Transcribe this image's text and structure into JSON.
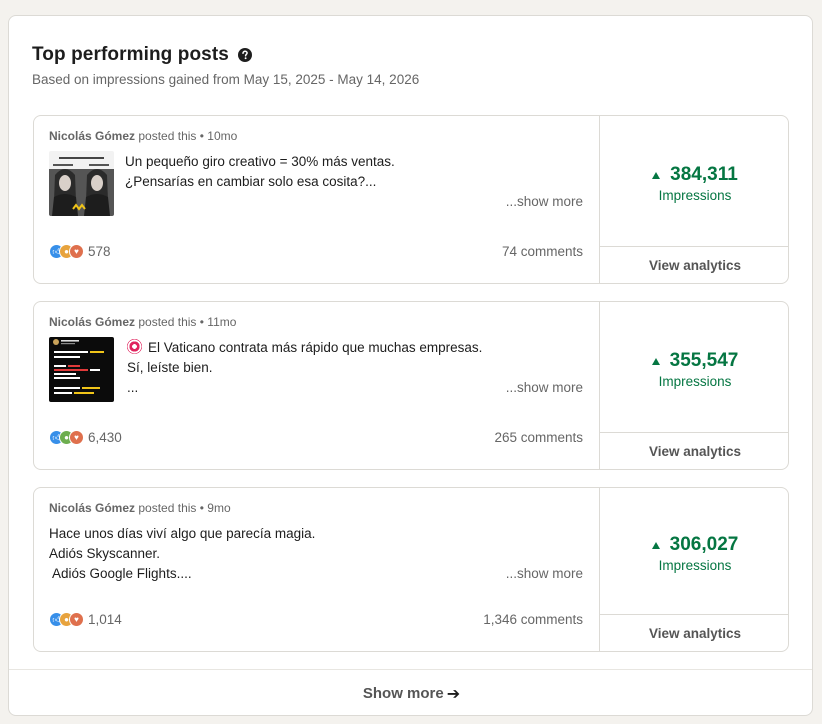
{
  "header": {
    "title": "Top performing posts",
    "help_icon": "question-circle-icon",
    "subtitle": "Based on impressions gained from May 15, 2025 - May 14, 2026"
  },
  "posts": [
    {
      "author": "Nicolás Gómez",
      "posted_this": "posted this",
      "age": "• 10mo",
      "lines": [
        "Un pequeño giro creativo = 30% más ventas.",
        "",
        "¿Pensarías en cambiar solo esa cosita?..."
      ],
      "show_more": "...show more",
      "reaction_count": "578",
      "comments": "74 comments",
      "impressions": "384,311",
      "impressions_label": "Impressions",
      "analytics_label": "View analytics"
    },
    {
      "author": "Nicolás Gómez",
      "posted_this": "posted this",
      "age": "• 11mo",
      "lines": [
        "El Vaticano contrata más rápido que muchas empresas.",
        "Sí, leíste bien.",
        "..."
      ],
      "show_more": "...show more",
      "reaction_count": "6,430",
      "comments": "265 comments",
      "impressions": "355,547",
      "impressions_label": "Impressions",
      "analytics_label": "View analytics"
    },
    {
      "author": "Nicolás Gómez",
      "posted_this": "posted this",
      "age": "• 9mo",
      "lines": [
        "Hace unos días viví algo que parecía magia.",
        "Adiós Skyscanner.",
        " Adiós Google Flights...."
      ],
      "show_more": "...show more",
      "reaction_count": "1,014",
      "comments": "1,346 comments",
      "impressions": "306,027",
      "impressions_label": "Impressions",
      "analytics_label": "View analytics"
    }
  ],
  "footer": {
    "show_more": "Show more",
    "arrow_icon": "arrow-right-icon"
  },
  "colors": {
    "accent_green": "#057642",
    "like_blue": "#378fe9",
    "love_red": "#df704d"
  }
}
